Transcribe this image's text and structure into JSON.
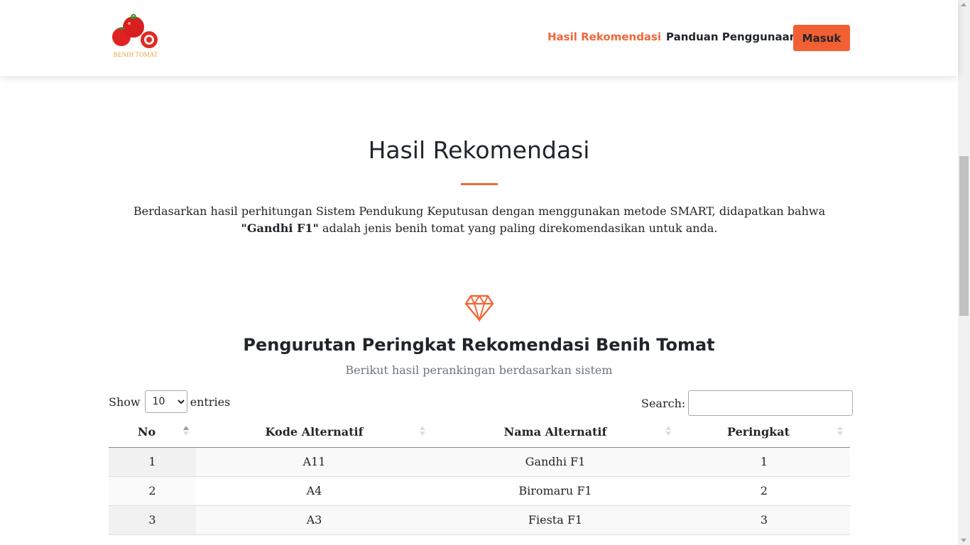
{
  "brand": {
    "logo_text": "BENIH TOMAT"
  },
  "nav": {
    "items": [
      {
        "label": "Hasil Rekomendasi",
        "active": true
      },
      {
        "label": "Panduan Penggunaan",
        "active": false
      }
    ],
    "login_label": "Masuk"
  },
  "header": {
    "title": "Hasil Rekomendasi",
    "description_pre": "Berdasarkan hasil perhitungan Sistem Pendukung Keputusan dengan menggunakan metode SMART, didapatkan bahwa ",
    "description_bold": "\"Gandhi F1\"",
    "description_post": " adalah jenis benih tomat yang paling direkomendasikan untuk anda."
  },
  "ranking": {
    "icon": "diamond-icon",
    "title": "Pengurutan Peringkat Rekomendasi Benih Tomat",
    "subtitle": "Berikut hasil perankingan berdasarkan sistem"
  },
  "table_controls": {
    "show_label": "Show",
    "entries_value": "10",
    "entries_label": "entries",
    "search_label": "Search:",
    "search_value": ""
  },
  "table": {
    "columns": [
      "No",
      "Kode Alternatif",
      "Nama Alternatif",
      "Peringkat"
    ],
    "sorted_column": "No",
    "rows": [
      [
        "1",
        "A11",
        "Gandhi F1",
        "1"
      ],
      [
        "2",
        "A4",
        "Biromaru F1",
        "2"
      ],
      [
        "3",
        "A3",
        "Fiesta F1",
        "3"
      ]
    ]
  },
  "colors": {
    "accent": "#f26838",
    "button": "#f15f33",
    "text": "#212529",
    "muted": "#6c757d"
  }
}
